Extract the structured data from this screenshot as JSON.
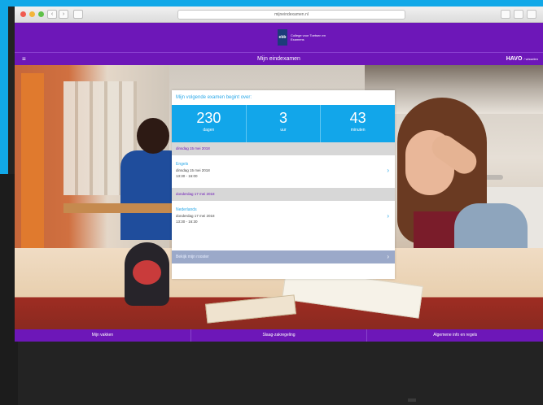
{
  "browser": {
    "url": "mijneindexamen.nl"
  },
  "header": {
    "logo_mark": "ebb",
    "logo_text": "College voor Toetsen en Examens"
  },
  "subbar": {
    "menu_icon": "menu-icon",
    "title": "Mijn eindexamen",
    "level": "HAVO",
    "level_sub": "/ wisselen"
  },
  "countdown": {
    "title": "Mijn volgende examen begint over:",
    "days_value": "230",
    "days_label": "dagen",
    "hours_value": "3",
    "hours_label": "uur",
    "minutes_value": "43",
    "minutes_label": "minuten"
  },
  "exams": [
    {
      "day": "dinsdag 15 mei 2018",
      "subject": "Engels",
      "date": "dinsdag 15 mei 2018",
      "time": "13:30 - 16:00"
    },
    {
      "day": "donderdag 17 mei 2018",
      "subject": "Nederlands",
      "date": "donderdag 17 mei 2018",
      "time": "13:30 - 16:30"
    }
  ],
  "see_all": "Bekijk mijn rooster",
  "bottom_nav": {
    "item1": "Mijn vakken",
    "item2": "Slaag-zakregeling",
    "item3": "Algemene info en regels"
  },
  "colors": {
    "purple": "#6d17b8",
    "cyan": "#12a6ea"
  }
}
